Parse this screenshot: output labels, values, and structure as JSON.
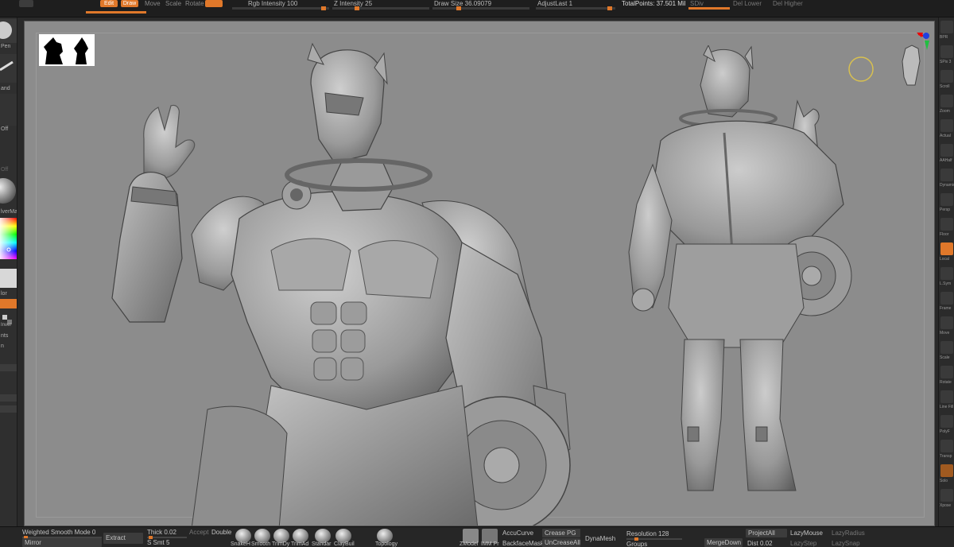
{
  "topbar": {
    "tabs": [
      "Edit",
      "Draw",
      "Move",
      "Scale",
      "Rotate"
    ],
    "rgb_intensity": "Rgb Intensity 100",
    "z_intensity": "Z Intensity 25",
    "draw_size": "Draw Size 36.09079",
    "adjust_last": "AdjustLast 1",
    "total_points": "TotalPoints: 37.501 Mil",
    "sdiv": "SDiv",
    "del_lower": "Del Lower",
    "del_higher": "Del Higher"
  },
  "left_tray": {
    "pen_label": "Pen",
    "hand_label": "and",
    "off_label": "Off",
    "off2_label": "Off",
    "material_label": "lverMat",
    "color_label": "lor",
    "invert_label": "Inver",
    "nts_label": "nts",
    "n_label": "n"
  },
  "right_tray": {
    "labels": [
      "BPR",
      "SPix 3",
      "Scroll",
      "Zoom",
      "Actual",
      "AAHalf",
      "Dynamic",
      "Persp",
      "Floor",
      "Local",
      "L.Sym",
      "Frame",
      "Move",
      "Scale",
      "Rotate",
      "Line Fill",
      "PolyF",
      "Transp",
      "Solo",
      "Xpose"
    ]
  },
  "bottombar": {
    "weighted_smooth": "Weighted Smooth Mode 0",
    "mirror": "Mirror",
    "extract": "Extract",
    "thick": "Thick 0.02",
    "accept": "Accept",
    "double": "Double",
    "s_smt": "S Smt 5",
    "brushes": [
      "SnakeH",
      "Smooth",
      "TrimDy",
      "TrimAd",
      "Standar",
      "ClayBuil",
      "Topology"
    ],
    "zmodeler": "ZModel",
    "imm": "IMM Pr",
    "accucurve": "AccuCurve",
    "backface_mask": "BackfaceMask",
    "crease_pg": "Crease PG",
    "uncrease_all": "UnCreaseAll",
    "dynamesh": "DynaMesh",
    "resolution": "Resolution 128",
    "groups": "Groups",
    "project_all": "ProjectAll",
    "merge_down": "MergeDown",
    "lazy_mouse": "LazyMouse",
    "dist": "Dist 0.02",
    "lazy_radius": "LazyRadius",
    "lazy_step": "LazyStep",
    "lazy_snap": "LazySnap"
  },
  "colors": {
    "accent": "#e0782a",
    "canvas": "#8c8c8c",
    "ui_dark": "#262626"
  }
}
